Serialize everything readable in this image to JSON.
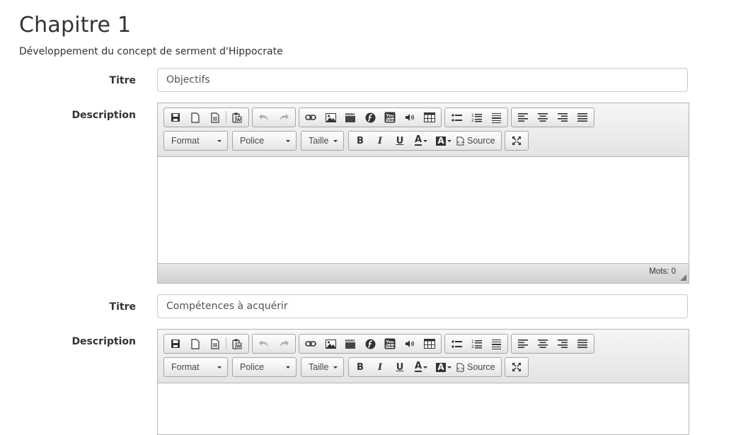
{
  "page": {
    "title": "Chapitre 1",
    "subtitle": "Développement du concept de serment d'Hippocrate"
  },
  "labels": {
    "titre": "Titre",
    "description": "Description"
  },
  "sections": [
    {
      "titre_value": "Objectifs",
      "word_count": "Mots: 0"
    },
    {
      "titre_value": "Compétences à acquérir"
    }
  ],
  "toolbar": {
    "format": "Format",
    "font": "Police",
    "size": "Taille",
    "bold": "B",
    "italic": "I",
    "underline": "U",
    "text_color": "A",
    "bg_color": "A",
    "source": "Source",
    "icons": [
      "save-icon",
      "new-page-icon",
      "templates-icon",
      "paste-word-icon",
      "undo-icon",
      "redo-icon",
      "link-icon",
      "image-icon",
      "video-icon",
      "flash-icon",
      "youtube-icon",
      "audio-icon",
      "table-icon",
      "bulleted-list-icon",
      "numbered-list-icon",
      "horizontal-line-icon",
      "align-left-icon",
      "align-center-icon",
      "align-right-icon",
      "justify-icon",
      "maximize-icon"
    ]
  }
}
